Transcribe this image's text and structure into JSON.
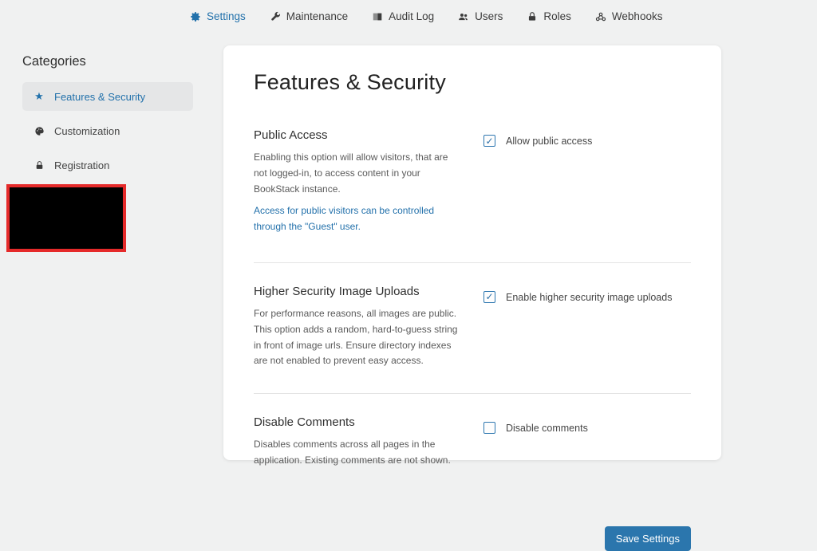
{
  "nav": {
    "items": [
      {
        "label": "Settings",
        "icon": "gear-icon",
        "active": true
      },
      {
        "label": "Maintenance",
        "icon": "wrench-icon",
        "active": false
      },
      {
        "label": "Audit Log",
        "icon": "book-icon",
        "active": false
      },
      {
        "label": "Users",
        "icon": "users-icon",
        "active": false
      },
      {
        "label": "Roles",
        "icon": "lock-icon",
        "active": false
      },
      {
        "label": "Webhooks",
        "icon": "webhook-icon",
        "active": false
      }
    ]
  },
  "sidebar": {
    "title": "Categories",
    "items": [
      {
        "label": "Features & Security",
        "icon": "star-icon",
        "active": true
      },
      {
        "label": "Customization",
        "icon": "palette-icon",
        "active": false
      },
      {
        "label": "Registration",
        "icon": "lock-icon",
        "active": false
      }
    ],
    "redaction": "redacted-region"
  },
  "main": {
    "title": "Features & Security",
    "sections": [
      {
        "heading": "Public Access",
        "description": "Enabling this option will allow visitors, that are not logged-in, to access content in your BookStack instance.",
        "link": "Access for public visitors can be controlled through the \"Guest\" user.",
        "checkbox": {
          "label": "Allow public access",
          "checked": true
        }
      },
      {
        "heading": "Higher Security Image Uploads",
        "description": "For performance reasons, all images are public. This option adds a random, hard-to-guess string in front of image urls. Ensure directory indexes are not enabled to prevent easy access.",
        "checkbox": {
          "label": "Enable higher security image uploads",
          "checked": true
        }
      },
      {
        "heading": "Disable Comments",
        "description": "Disables comments across all pages in the application. Existing comments are not shown.",
        "checkbox": {
          "label": "Disable comments",
          "checked": false
        }
      }
    ],
    "save_button": "Save Settings"
  },
  "colors": {
    "accent_blue": "#2271ab",
    "button_blue": "#2b76ad",
    "page_background": "#f0f1f1",
    "panel_background": "#ffffff",
    "active_item_background": "#e5e6e7",
    "redaction_fill": "#000000",
    "redaction_border": "#e52a2a"
  }
}
